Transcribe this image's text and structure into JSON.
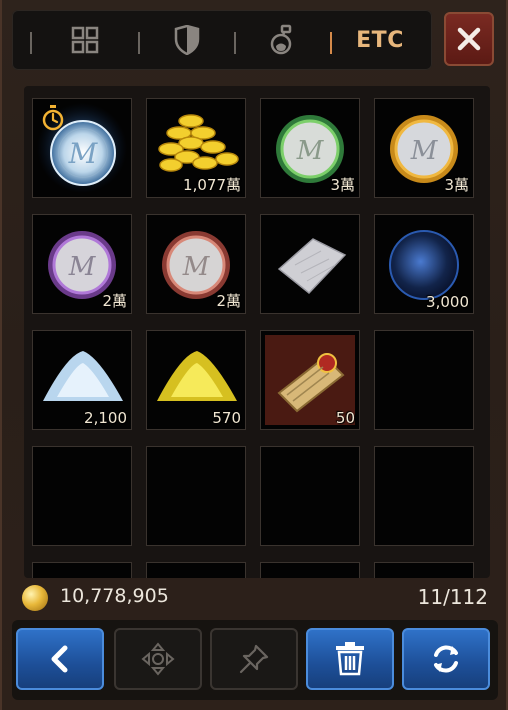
{
  "tabs": [
    {
      "name": "all-items",
      "icon": "grid-icon"
    },
    {
      "name": "equipment",
      "icon": "shield-icon"
    },
    {
      "name": "consumables",
      "icon": "potion-icon"
    },
    {
      "name": "etc",
      "label": "ETC",
      "active": true
    }
  ],
  "close_icon": "close-icon",
  "slots": [
    {
      "item": "silver-medal-timed",
      "qty": ""
    },
    {
      "item": "gold-coins",
      "qty": "1,077萬"
    },
    {
      "item": "green-medal",
      "qty": "3萬"
    },
    {
      "item": "gold-medal",
      "qty": "3萬"
    },
    {
      "item": "purple-medal",
      "qty": "2萬"
    },
    {
      "item": "red-medal",
      "qty": "2萬"
    },
    {
      "item": "white-cloth",
      "qty": ""
    },
    {
      "item": "blue-orb",
      "qty": "3,000"
    },
    {
      "item": "silver-dust",
      "qty": "2,100"
    },
    {
      "item": "gold-dust",
      "qty": "570"
    },
    {
      "item": "scroll",
      "qty": "50"
    },
    {
      "item": "empty",
      "qty": ""
    },
    {
      "item": "empty",
      "qty": ""
    },
    {
      "item": "empty",
      "qty": ""
    },
    {
      "item": "empty",
      "qty": ""
    },
    {
      "item": "empty",
      "qty": ""
    }
  ],
  "footer": {
    "gold_amount": "10,778,905",
    "slot_count": "11/112"
  },
  "buttons": [
    {
      "name": "back-button",
      "icon": "chevron-left-icon",
      "enabled": true
    },
    {
      "name": "move-button",
      "icon": "move-icon",
      "enabled": false
    },
    {
      "name": "pin-button",
      "icon": "pin-icon",
      "enabled": false
    },
    {
      "name": "trash-button",
      "icon": "trash-icon",
      "enabled": true
    },
    {
      "name": "refresh-button",
      "icon": "refresh-icon",
      "enabled": true
    }
  ],
  "colors": {
    "accent": "#e7b67c",
    "button_blue": "#2f72c8",
    "close_red": "#7a2a22"
  }
}
